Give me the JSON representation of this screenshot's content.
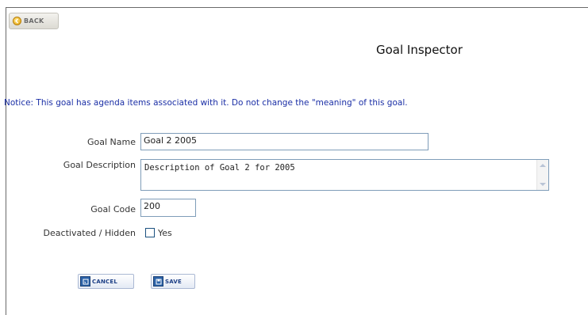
{
  "toolbar": {
    "back_label": "BACK"
  },
  "page": {
    "title": "Goal Inspector",
    "notice": "Notice: This goal has agenda items associated with it.  Do not change the \"meaning\" of this goal."
  },
  "form": {
    "goal_name": {
      "label": "Goal Name",
      "value": "Goal 2 2005"
    },
    "goal_description": {
      "label": "Goal Description",
      "value": "Description of Goal 2 for 2005"
    },
    "goal_code": {
      "label": "Goal Code",
      "value": "200"
    },
    "deactivated": {
      "label": "Deactivated / Hidden",
      "option_label": "Yes",
      "checked": false
    }
  },
  "actions": {
    "cancel_label": "CANCEL",
    "save_label": "SAVE"
  },
  "icons": {
    "back": "back-arrow-icon",
    "cancel": "cancel-icon",
    "save": "save-icon",
    "scroll_up": "chevron-up-icon",
    "scroll_down": "chevron-down-icon"
  },
  "colors": {
    "notice": "#1b2fa6",
    "input_border": "#7f9db9",
    "action_text": "#1c3f86"
  }
}
